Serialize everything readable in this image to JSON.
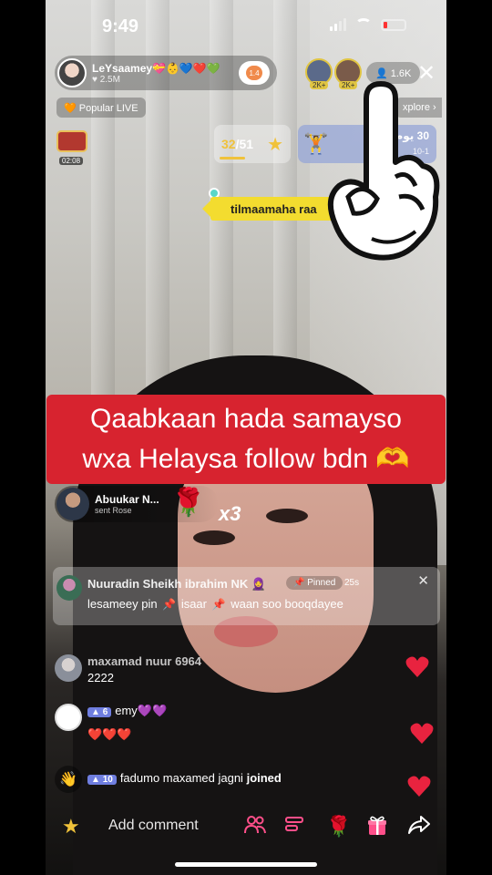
{
  "status_bar": {
    "time": "9:49"
  },
  "host": {
    "name": "LeYsaamey💝👶💙❤️💚",
    "likes": "♥ 2.5M",
    "follow_badge": "1.4"
  },
  "viewers": {
    "badge1": "2K+",
    "badge2": "2K+",
    "count": "👤 1.6K"
  },
  "tags": {
    "popular": "🧡 Popular LIVE",
    "explore": "xplore ›"
  },
  "treasure": {
    "timer": "02:08"
  },
  "goal": {
    "current": "32",
    "total": "/51"
  },
  "fitness_widget": {
    "days": "30 يوم",
    "sub": "10-1"
  },
  "tag_label": "tilmaamaha raa",
  "banner": {
    "line1": "Qaabkaan hada samayso",
    "line2": "wxa Helaysa follow bdn 🫶"
  },
  "gift": {
    "sender": "Abuukar N...",
    "action": "sent Rose",
    "combo": "x3"
  },
  "pinned": {
    "name": "Nuuradin Sheikh ibrahim NK 🧕",
    "badge": "📌 Pinned",
    "time": "25s",
    "text_part1": "lesameey pin",
    "text_part2": "isaar",
    "text_part3": "waan soo booqdayee"
  },
  "comments": [
    {
      "name": "maxamad nuur 6964",
      "text": "2222"
    },
    {
      "level": "6",
      "name": "emy💜💜",
      "text": "❤️❤️❤️"
    },
    {
      "level": "10",
      "name": "fadumo maxamed jagni",
      "action": "joined"
    }
  ],
  "bottom_bar": {
    "placeholder": "Add comment"
  },
  "colors": {
    "banner": "#d7232f",
    "accent": "#f0c23a",
    "heart": "#e8233f"
  }
}
